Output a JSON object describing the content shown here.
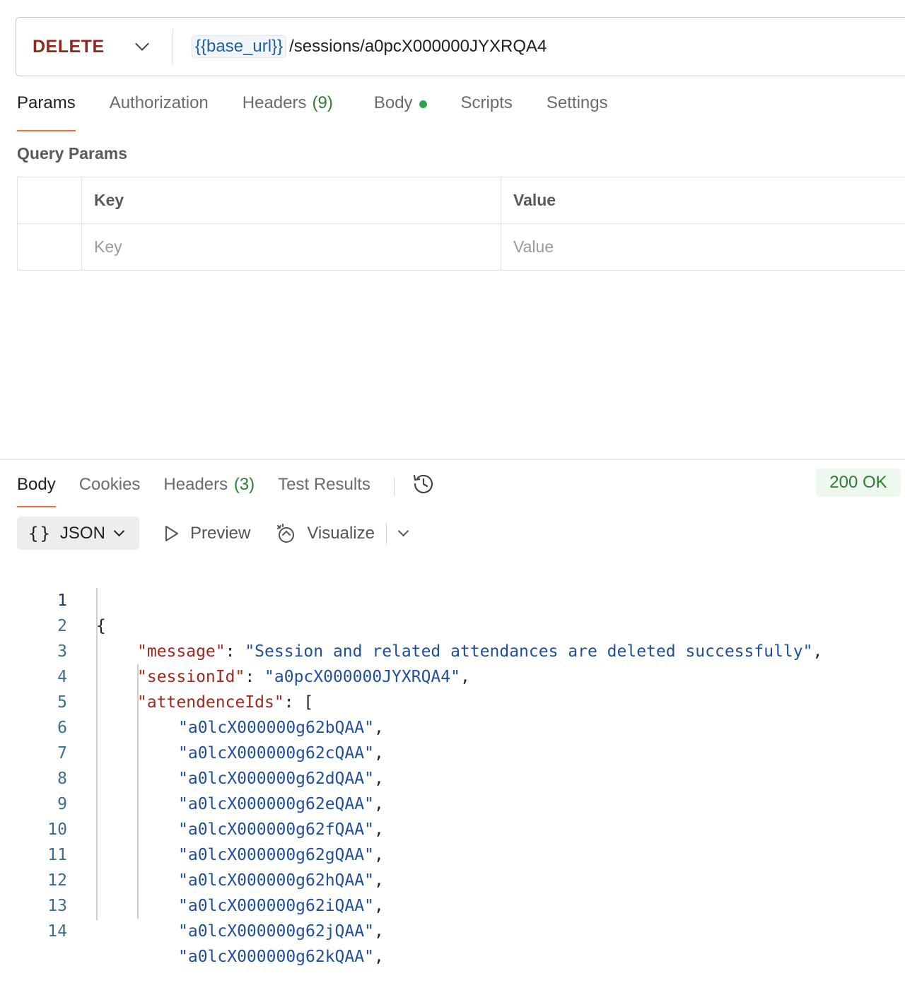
{
  "request": {
    "method": "DELETE",
    "url_variable": "{{base_url}}",
    "url_path": "/sessions/a0pcX000000JYXRQA4"
  },
  "request_tabs": [
    {
      "label": "Params",
      "active": true
    },
    {
      "label": "Authorization"
    },
    {
      "label": "Headers",
      "count": "(9)"
    },
    {
      "label": "Body",
      "indicator": "green-dot"
    },
    {
      "label": "Scripts"
    },
    {
      "label": "Settings"
    }
  ],
  "query_params": {
    "title": "Query Params",
    "header_key": "Key",
    "header_value": "Value",
    "placeholder_key": "Key",
    "placeholder_value": "Value"
  },
  "response_tabs": [
    {
      "label": "Body",
      "active": true
    },
    {
      "label": "Cookies"
    },
    {
      "label": "Headers",
      "count": "(3)"
    },
    {
      "label": "Test Results"
    }
  ],
  "status": "200 OK",
  "toolbar": {
    "format": "JSON",
    "preview": "Preview",
    "visualize": "Visualize"
  },
  "code_lines": [
    {
      "n": "1",
      "text": "{"
    },
    {
      "n": "2",
      "key": "\"message\"",
      "sep": ": ",
      "value": "\"Session and related attendances are deleted successfully\"",
      "tail": ","
    },
    {
      "n": "3",
      "key": "\"sessionId\"",
      "sep": ": ",
      "value": "\"a0pcX000000JYXRQA4\"",
      "tail": ","
    },
    {
      "n": "4",
      "key": "\"attendenceIds\"",
      "sep": ": ",
      "tail": "["
    },
    {
      "n": "5",
      "value": "\"a0lcX000000g62bQAA\"",
      "tail": ","
    },
    {
      "n": "6",
      "value": "\"a0lcX000000g62cQAA\"",
      "tail": ","
    },
    {
      "n": "7",
      "value": "\"a0lcX000000g62dQAA\"",
      "tail": ","
    },
    {
      "n": "8",
      "value": "\"a0lcX000000g62eQAA\"",
      "tail": ","
    },
    {
      "n": "9",
      "value": "\"a0lcX000000g62fQAA\"",
      "tail": ","
    },
    {
      "n": "10",
      "value": "\"a0lcX000000g62gQAA\"",
      "tail": ","
    },
    {
      "n": "11",
      "value": "\"a0lcX000000g62hQAA\"",
      "tail": ","
    },
    {
      "n": "12",
      "value": "\"a0lcX000000g62iQAA\"",
      "tail": ","
    },
    {
      "n": "13",
      "value": "\"a0lcX000000g62jQAA\"",
      "tail": ","
    },
    {
      "n": "14",
      "value": "\"a0lcX000000g62kQAA\"",
      "tail": ","
    }
  ],
  "colors": {
    "method": "#8f2a1e",
    "accent_underline": "#f26b3a",
    "status_green": "#2e7d32",
    "json_key": "#a3271f",
    "json_string": "#1f4f9c"
  }
}
